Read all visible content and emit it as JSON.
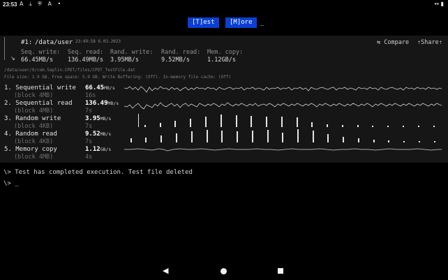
{
  "status_bar": {
    "time": "23:53",
    "icons": [
      "A",
      "⤓",
      "⛨",
      "A",
      "•"
    ],
    "right_icon": "↔ ▮"
  },
  "menu": {
    "test_label": "[T]est",
    "more_label": "[M]ore",
    "cursor": "_"
  },
  "header": {
    "number": "#1:",
    "path": "/data/user",
    "timestamp": "23:49:58 6.03.2023",
    "compare_label": "⇆ Compare",
    "share_label": "⇡Share⇡",
    "arrow_icon": "↘"
  },
  "summary": {
    "labels": [
      "Seq. write:",
      "Seq. read:",
      "Rand. write:",
      "Rand. read:",
      "Mem. copy:"
    ],
    "values": [
      "66.45MB/s",
      "136.49MB/s",
      "3.95MB/s",
      "9.52MB/s",
      "1.12GB/s"
    ]
  },
  "file_info": {
    "path": "/data/user/0/com.Saplin.CPDT/files/CPDT_TestFile.dat",
    "details": "File size: 1.9 GB. Free space: 5.9 GB. Write Buffering: (Off). In-memory file cache: (Off)"
  },
  "rows": [
    {
      "name": "1. Sequential write",
      "sub": "(block 4MB)",
      "value": "66.45",
      "unit": "MB/s",
      "time": "16s"
    },
    {
      "name": "2. Sequential read",
      "sub": "(block 4MB)",
      "value": "136.49",
      "unit": "MB/s",
      "time": "7s"
    },
    {
      "name": "3. Random write",
      "sub": "(block 4KB)",
      "value": "3.95",
      "unit": "MB/s",
      "time": "7s"
    },
    {
      "name": "4. Random read",
      "sub": "(block 4KB)",
      "value": "9.52",
      "unit": "MB/s",
      "time": "7s"
    },
    {
      "name": "5. Memory copy",
      "sub": "(block 4MB)",
      "value": "1.12",
      "unit": "GB/s",
      "time": "4s"
    }
  ],
  "log": {
    "line1": "\\> Test has completed execution. Test file deleted",
    "line2": "\\> _"
  },
  "colors": {
    "menu_button": "#0b3fd4",
    "panel_bg": "#161616",
    "background": "#000000"
  }
}
